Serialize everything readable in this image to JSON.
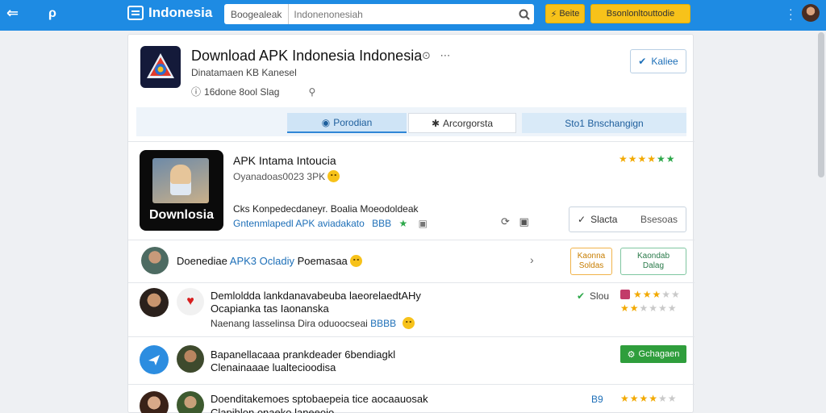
{
  "topbar": {
    "back_icon": "⇐",
    "pin_icon": "ρ",
    "brand": "Indonesia",
    "search_chip": "Boogealeak",
    "search_placeholder": "Indonenonesiah",
    "btn_small": "Beite",
    "btn_wide": "Bsonlonltouttodie"
  },
  "app": {
    "title": "Download APK Indonesia Indonesia",
    "subtitle": "Dinatamaen KB Kanesel",
    "meta": "16done 8ool Slag",
    "follow_label": "Kaliee"
  },
  "tabs": [
    {
      "label": "Porodian"
    },
    {
      "label": "Arcorgorsta"
    },
    {
      "label": "Sto1 Bnschangign"
    }
  ],
  "featured": {
    "image_label": "Downlosia",
    "title": "APK Intama Intoucia",
    "subtitle": "Oyanadoas0023 3PK",
    "desc": "Cks Konpedecdaneyr. Boalia Moeodoldeak",
    "link": "Gntenmlapedl APK aviadakato",
    "link_tag": "BBB",
    "share_label": "Slacta",
    "share_right": "Bsesoas"
  },
  "rows": [
    {
      "text_a": "Doenediae",
      "text_b": "APK3 Ocladiy",
      "text_c": "Poemasaa",
      "badge1": "Kaonna\nSoldas",
      "badge2": "Kaondab\nDalag"
    },
    {
      "line1": "Demloldda lankdanavabeuba laeorelaedtAHy",
      "line2": "Ocapianka tas Iaonanska",
      "line3": "Naenang lasselinsa  Dira  oduoocseai",
      "line3_tag": "BBBB",
      "status": "Slou"
    },
    {
      "line1": "Bapanellacaaa prankdeader 6bendiagkl",
      "line2": "Clenainaaae lualtecioodisa",
      "action": "Gchagaen"
    },
    {
      "line1": "Doenditakemoes sptobaepeia tice aocaauosak",
      "line2": "Clapihlon onaeko laneeoio",
      "tag": "B9"
    }
  ]
}
